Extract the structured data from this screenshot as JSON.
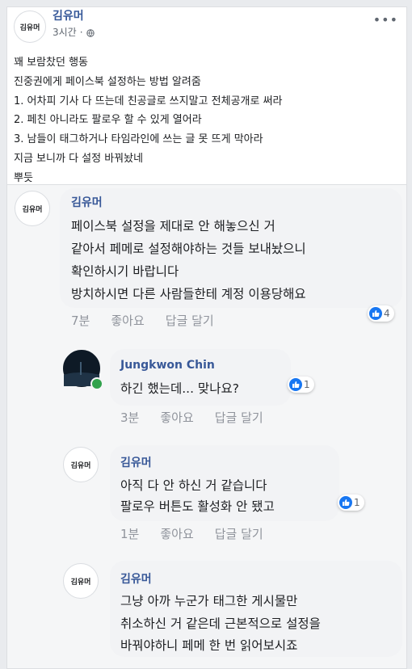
{
  "post": {
    "author": "김유머",
    "avatar_text": "김유머",
    "time": "3시간",
    "more": "•••",
    "lines": [
      "꽤 보람찼던 행동",
      "진중권에게 페이스북 설정하는 방법 알려줌",
      "1. 어차피 기사 다 뜨는데 친공글로 쓰지말고 전체공개로 써라",
      "2. 페친 아니라도 팔로우 할 수 있게 열어라",
      "3. 남들이 태그하거나 타임라인에 쓰는 글 못 뜨게 막아라",
      "지금 보니까 다 설정 바꿔놨네",
      "뿌듯"
    ]
  },
  "comments": [
    {
      "author": "김유머",
      "avatar_text": "김유머",
      "lines": [
        "페이스북 설정을 제대로 안 해놓으신 거",
        "같아서 페메로 설정해야하는 것들 보내놨으니",
        "확인하시기 바랍니다",
        "방치하시면 다른 사람들한테 계정 이용당해요"
      ],
      "time": "7분",
      "like": "좋아요",
      "reply": "답글 달기",
      "reactions": "4"
    },
    {
      "author": "Jungkwon Chin",
      "lines": [
        "하긴 했는데... 맞나요?"
      ],
      "time": "3분",
      "like": "좋아요",
      "reply": "답글 달기",
      "reactions": "1"
    },
    {
      "author": "김유머",
      "avatar_text": "김유머",
      "lines": [
        "아직 다 안 하신 거 같습니다",
        "팔로우 버튼도 활성화 안 됐고"
      ],
      "time": "1분",
      "like": "좋아요",
      "reply": "답글 달기",
      "reactions": "1"
    },
    {
      "author": "김유머",
      "avatar_text": "김유머",
      "lines": [
        "그냥 아까 누군가 태그한 게시물만",
        "취소하신 거 같은데 근본적으로 설정을",
        "바꿔야하니 페메 한 번 읽어보시죠"
      ]
    }
  ],
  "colors": {
    "link_name": "#385898",
    "like_blue": "#1877f2",
    "online": "#31a24c"
  }
}
